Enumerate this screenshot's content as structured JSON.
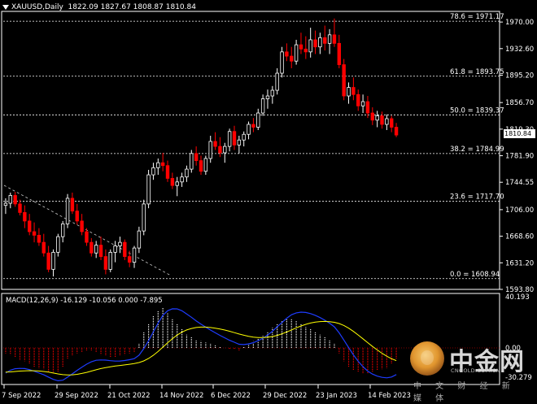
{
  "header": {
    "symbol_line": "XAUUSD,Daily",
    "ohlc": "1822.09 1827.67 1808.87 1810.84"
  },
  "macd_header": "MACD(12,26,9) -16.129 -10.056 0.000 -7.895",
  "current_price": "1810.84",
  "price_axis_labels": [
    "1970.00",
    "1932.60",
    "1895.20",
    "1856.70",
    "1819.30",
    "1781.90",
    "1744.55",
    "1706.00",
    "1668.60",
    "1631.20",
    "1593.80"
  ],
  "macd_axis_labels": [
    "40.193",
    "0.00",
    "-30.279"
  ],
  "date_labels": [
    "7 Sep 2022",
    "29 Sep 2022",
    "21 Oct 2022",
    "14 Nov 2022",
    "6 Dec 2022",
    "29 Dec 2022",
    "23 Jan 2023",
    "14 Feb 2023"
  ],
  "fib_levels": [
    {
      "label": "78.6 = 1971.17",
      "price": 1971.17
    },
    {
      "label": "61.8 = 1893.75",
      "price": 1893.75
    },
    {
      "label": "50.0 = 1839.37",
      "price": 1839.37
    },
    {
      "label": "38.2 = 1784.99",
      "price": 1784.99
    },
    {
      "label": "23.6 = 1717.70",
      "price": 1717.7
    },
    {
      "label": "0.0 = 1608.94",
      "price": 1608.94
    }
  ],
  "logo": {
    "brand": "中金网",
    "domain": "CNGOLD.COM.CN",
    "slogan": "中 文 财 经 新 媒 体"
  },
  "colors": {
    "up": "#ffffff",
    "down": "#ff0000",
    "macd_line": "#1e3cff",
    "signal_line": "#ffff00",
    "grid": "#ffffff"
  },
  "chart_data": {
    "type": "candlestick",
    "symbol": "XAUUSD",
    "timeframe": "Daily",
    "ylim": [
      1593.8,
      1985
    ],
    "candles": [
      [
        1712,
        1722,
        1700,
        1715
      ],
      [
        1715,
        1730,
        1708,
        1726
      ],
      [
        1726,
        1731,
        1710,
        1714
      ],
      [
        1714,
        1720,
        1698,
        1702
      ],
      [
        1702,
        1712,
        1680,
        1690
      ],
      [
        1690,
        1700,
        1670,
        1675
      ],
      [
        1675,
        1688,
        1660,
        1670
      ],
      [
        1670,
        1680,
        1655,
        1660
      ],
      [
        1660,
        1672,
        1640,
        1645
      ],
      [
        1645,
        1655,
        1618,
        1622
      ],
      [
        1622,
        1650,
        1612,
        1646
      ],
      [
        1646,
        1672,
        1640,
        1668
      ],
      [
        1668,
        1690,
        1660,
        1686
      ],
      [
        1686,
        1728,
        1680,
        1722
      ],
      [
        1722,
        1730,
        1700,
        1704
      ],
      [
        1704,
        1714,
        1685,
        1690
      ],
      [
        1690,
        1700,
        1670,
        1675
      ],
      [
        1675,
        1680,
        1655,
        1660
      ],
      [
        1660,
        1666,
        1640,
        1645
      ],
      [
        1645,
        1662,
        1638,
        1656
      ],
      [
        1656,
        1668,
        1635,
        1640
      ],
      [
        1640,
        1650,
        1615,
        1622
      ],
      [
        1622,
        1650,
        1618,
        1646
      ],
      [
        1646,
        1662,
        1632,
        1655
      ],
      [
        1655,
        1668,
        1645,
        1660
      ],
      [
        1660,
        1664,
        1635,
        1640
      ],
      [
        1640,
        1648,
        1625,
        1632
      ],
      [
        1632,
        1655,
        1624,
        1652
      ],
      [
        1652,
        1682,
        1645,
        1676
      ],
      [
        1676,
        1720,
        1670,
        1714
      ],
      [
        1714,
        1762,
        1708,
        1755
      ],
      [
        1755,
        1772,
        1748,
        1765
      ],
      [
        1765,
        1778,
        1755,
        1772
      ],
      [
        1772,
        1786,
        1760,
        1768
      ],
      [
        1768,
        1775,
        1745,
        1750
      ],
      [
        1750,
        1758,
        1735,
        1740
      ],
      [
        1740,
        1752,
        1725,
        1745
      ],
      [
        1745,
        1758,
        1738,
        1752
      ],
      [
        1752,
        1768,
        1745,
        1763
      ],
      [
        1763,
        1790,
        1758,
        1785
      ],
      [
        1785,
        1795,
        1768,
        1775
      ],
      [
        1775,
        1782,
        1755,
        1760
      ],
      [
        1760,
        1782,
        1755,
        1778
      ],
      [
        1778,
        1810,
        1772,
        1802
      ],
      [
        1802,
        1815,
        1790,
        1795
      ],
      [
        1795,
        1808,
        1780,
        1786
      ],
      [
        1786,
        1800,
        1772,
        1795
      ],
      [
        1795,
        1820,
        1788,
        1816
      ],
      [
        1816,
        1824,
        1790,
        1797
      ],
      [
        1797,
        1810,
        1785,
        1804
      ],
      [
        1804,
        1816,
        1795,
        1812
      ],
      [
        1812,
        1830,
        1805,
        1826
      ],
      [
        1826,
        1835,
        1815,
        1822
      ],
      [
        1822,
        1848,
        1818,
        1842
      ],
      [
        1842,
        1868,
        1838,
        1862
      ],
      [
        1862,
        1875,
        1848,
        1866
      ],
      [
        1866,
        1880,
        1855,
        1874
      ],
      [
        1874,
        1905,
        1868,
        1898
      ],
      [
        1898,
        1935,
        1892,
        1928
      ],
      [
        1928,
        1940,
        1915,
        1922
      ],
      [
        1922,
        1935,
        1905,
        1915
      ],
      [
        1915,
        1945,
        1910,
        1938
      ],
      [
        1938,
        1955,
        1925,
        1932
      ],
      [
        1932,
        1950,
        1918,
        1928
      ],
      [
        1928,
        1962,
        1920,
        1945
      ],
      [
        1945,
        1958,
        1925,
        1935
      ],
      [
        1935,
        1955,
        1925,
        1948
      ],
      [
        1948,
        1965,
        1930,
        1940
      ],
      [
        1940,
        1960,
        1925,
        1952
      ],
      [
        1952,
        1975,
        1935,
        1940
      ],
      [
        1940,
        1952,
        1905,
        1910
      ],
      [
        1910,
        1918,
        1860,
        1866
      ],
      [
        1866,
        1885,
        1855,
        1878
      ],
      [
        1878,
        1892,
        1860,
        1868
      ],
      [
        1868,
        1875,
        1845,
        1852
      ],
      [
        1852,
        1868,
        1842,
        1858
      ],
      [
        1858,
        1866,
        1835,
        1842
      ],
      [
        1842,
        1850,
        1825,
        1832
      ],
      [
        1832,
        1845,
        1822,
        1838
      ],
      [
        1838,
        1844,
        1820,
        1826
      ],
      [
        1826,
        1840,
        1818,
        1834
      ],
      [
        1834,
        1838,
        1815,
        1822
      ],
      [
        1822,
        1828,
        1808,
        1811
      ]
    ],
    "macd_histogram": [
      -4,
      -5,
      -7,
      -9,
      -10,
      -12,
      -14,
      -15,
      -16,
      -18,
      -19,
      -18,
      -14,
      -8,
      -6,
      -4,
      -3,
      -2,
      -2,
      -3,
      -5,
      -6,
      -7,
      -7,
      -6,
      -5,
      -4,
      -3,
      3,
      12,
      18,
      24,
      28,
      30,
      26,
      22,
      18,
      14,
      10,
      8,
      6,
      5,
      4,
      3,
      2,
      1,
      0,
      -1,
      -1,
      -2,
      1,
      3,
      5,
      7,
      9,
      12,
      15,
      18,
      20,
      22,
      22,
      20,
      18,
      16,
      14,
      12,
      10,
      8,
      6,
      3,
      -4,
      -10,
      -14,
      -17,
      -18,
      -19,
      -19,
      -18,
      -17,
      -16,
      -15,
      -12,
      -8
    ],
    "macd_line_signal": "hidden"
  }
}
